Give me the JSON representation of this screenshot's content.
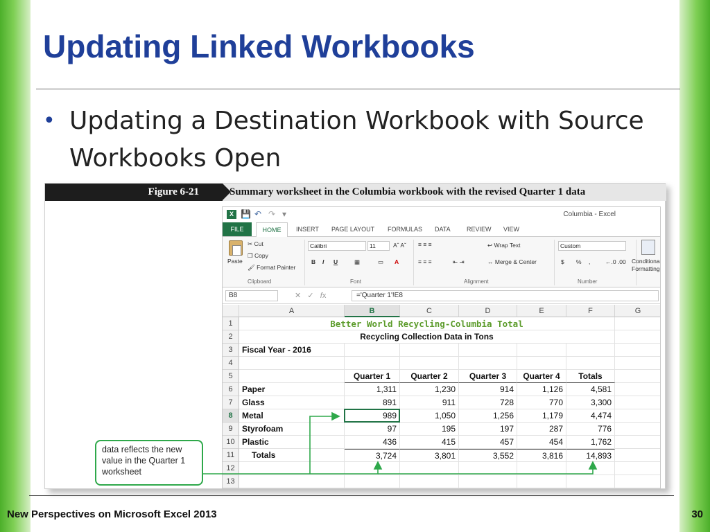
{
  "slide": {
    "title": "Updating Linked Workbooks",
    "bullet": "Updating a Destination Workbook with Source Workbooks Open",
    "footer_left": "New Perspectives on Microsoft Excel 2013",
    "page_number": "30"
  },
  "figure": {
    "label": "Figure 6-21",
    "caption": "Summary worksheet in the Columbia workbook with the revised Quarter 1 data",
    "callout": "data reflects the new value in the Quarter 1 worksheet"
  },
  "excel": {
    "window_title": "Columbia - Excel",
    "tabs": [
      "FILE",
      "HOME",
      "INSERT",
      "PAGE LAYOUT",
      "FORMULAS",
      "DATA",
      "REVIEW",
      "VIEW"
    ],
    "clipboard": {
      "paste": "Paste",
      "cut": "Cut",
      "copy": "Copy",
      "format_painter": "Format Painter",
      "group": "Clipboard"
    },
    "font": {
      "name": "Calibri",
      "size": "11",
      "group": "Font",
      "bold": "B",
      "italic": "I",
      "underline": "U"
    },
    "alignment": {
      "wrap": "Wrap Text",
      "merge": "Merge & Center",
      "group": "Alignment"
    },
    "number": {
      "format": "Custom",
      "currency": "$",
      "percent": "%",
      "comma": ",",
      "group": "Number"
    },
    "styles": {
      "conditional": "Conditional Formatting"
    },
    "name_box": "B8",
    "formula": "='Quarter 1'!E8",
    "columns": [
      "A",
      "B",
      "C",
      "D",
      "E",
      "F",
      "G"
    ],
    "row_numbers": [
      "1",
      "2",
      "3",
      "4",
      "5",
      "6",
      "7",
      "8",
      "9",
      "10",
      "11",
      "12",
      "13"
    ],
    "sheet": {
      "title": "Better World Recycling-Columbia Total",
      "subtitle": "Recycling Collection Data in Tons",
      "fiscal_year": "Fiscal Year - 2016",
      "headers": [
        "Quarter 1",
        "Quarter 2",
        "Quarter 3",
        "Quarter 4",
        "Totals"
      ],
      "rows": [
        {
          "label": "Paper",
          "values": [
            "1,311",
            "1,230",
            "914",
            "1,126",
            "4,581"
          ]
        },
        {
          "label": "Glass",
          "values": [
            "891",
            "911",
            "728",
            "770",
            "3,300"
          ]
        },
        {
          "label": "Metal",
          "values": [
            "989",
            "1,050",
            "1,256",
            "1,179",
            "4,474"
          ]
        },
        {
          "label": "Styrofoam",
          "values": [
            "97",
            "195",
            "197",
            "287",
            "776"
          ]
        },
        {
          "label": "Plastic",
          "values": [
            "436",
            "415",
            "457",
            "454",
            "1,762"
          ]
        }
      ],
      "totals_label": "Totals",
      "totals": [
        "3,724",
        "3,801",
        "3,552",
        "3,816",
        "14,893"
      ]
    }
  },
  "colors": {
    "title_blue": "#1f3f99",
    "excel_green": "#217346",
    "callout_green": "#2ea84a",
    "sheet_title_green": "#5b9b2a"
  }
}
